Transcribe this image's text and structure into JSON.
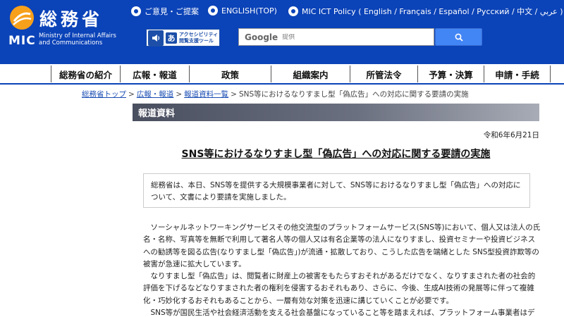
{
  "header": {
    "logo_title": "総務省",
    "logo_abbr": "MIC",
    "logo_en_line1": "Ministry of Internal Affairs",
    "logo_en_line2": "and Communications",
    "links": [
      {
        "label": "ご意見・ご提案"
      },
      {
        "label": "ENGLISH(TOP)"
      },
      {
        "label": "MIC ICT Policy ( English / Français / Español / Русский / 中文 / عربي )"
      }
    ],
    "accessibility_line1": "アクセシビリティ",
    "accessibility_line2": "閲覧支援ツール",
    "accessibility_icon_a": "あ",
    "search_brand": "Google",
    "search_placeholder": "提供"
  },
  "nav": {
    "items": [
      {
        "label": "総務省の紹介"
      },
      {
        "label": "広報・報道"
      },
      {
        "label": "政策"
      },
      {
        "label": "組織案内"
      },
      {
        "label": "所管法令"
      },
      {
        "label": "予算・決算"
      },
      {
        "label": "申請・手続"
      }
    ]
  },
  "breadcrumb": {
    "items": [
      {
        "label": "総務省トップ"
      },
      {
        "label": "広報・報道"
      },
      {
        "label": "報道資料一覧"
      }
    ],
    "current": "SNS等におけるなりすまし型「偽広告」への対応に関する要請の実施",
    "separator": ">"
  },
  "section": {
    "heading": "報道資料"
  },
  "article": {
    "date": "令和6年6月21日",
    "title": "SNS等におけるなりすまし型「偽広告」への対応に関する要請の実施",
    "summary": "総務省は、本日、SNS等を提供する大規模事業者に対して、SNS等におけるなりすまし型「偽広告」への対応について、文書により要請を実施しました。",
    "paragraphs": [
      "ソーシャルネットワーキングサービスその他交流型のプラットフォームサービス(SNS等)において、個人又は法人の氏名・名称、写真等を無断で利用して著名人等の個人又は有名企業等の法人になりすまし、投資セミナーや投資ビジネスへの勧誘等を図る広告(なりすまし型「偽広告」)が流通・拡散しており、こうした広告を端緒とした SNS型投資詐欺等の被害が急速に拡大しています。",
      "なりすまし型「偽広告」は、閲覧者に財産上の被害をもたらすおそれがあるだけでなく、なりすまされた者の社会的評価を下げるなどなりすまされた者の権利を侵害するおそれもあり、さらに、今後、生成AI技術の発展等に伴って複雑化・巧妙化するおそれもあることから、一層有効な対策を迅速に講じていくことが必要です。",
      "SNS等が国民生活や社会経済活動を支える社会基盤になっていること等を踏まえれば、プラットフォーム事業者はデジタ"
    ]
  },
  "colors": {
    "header_blue": "#0b43b8",
    "link_blue": "#1a4db3",
    "search_button": "#4285f4"
  },
  "icons": {
    "logo": "mic-logo-icon",
    "link_bullet": "circle-bullet-icon",
    "speaker": "speaker-icon",
    "search": "search-icon"
  }
}
